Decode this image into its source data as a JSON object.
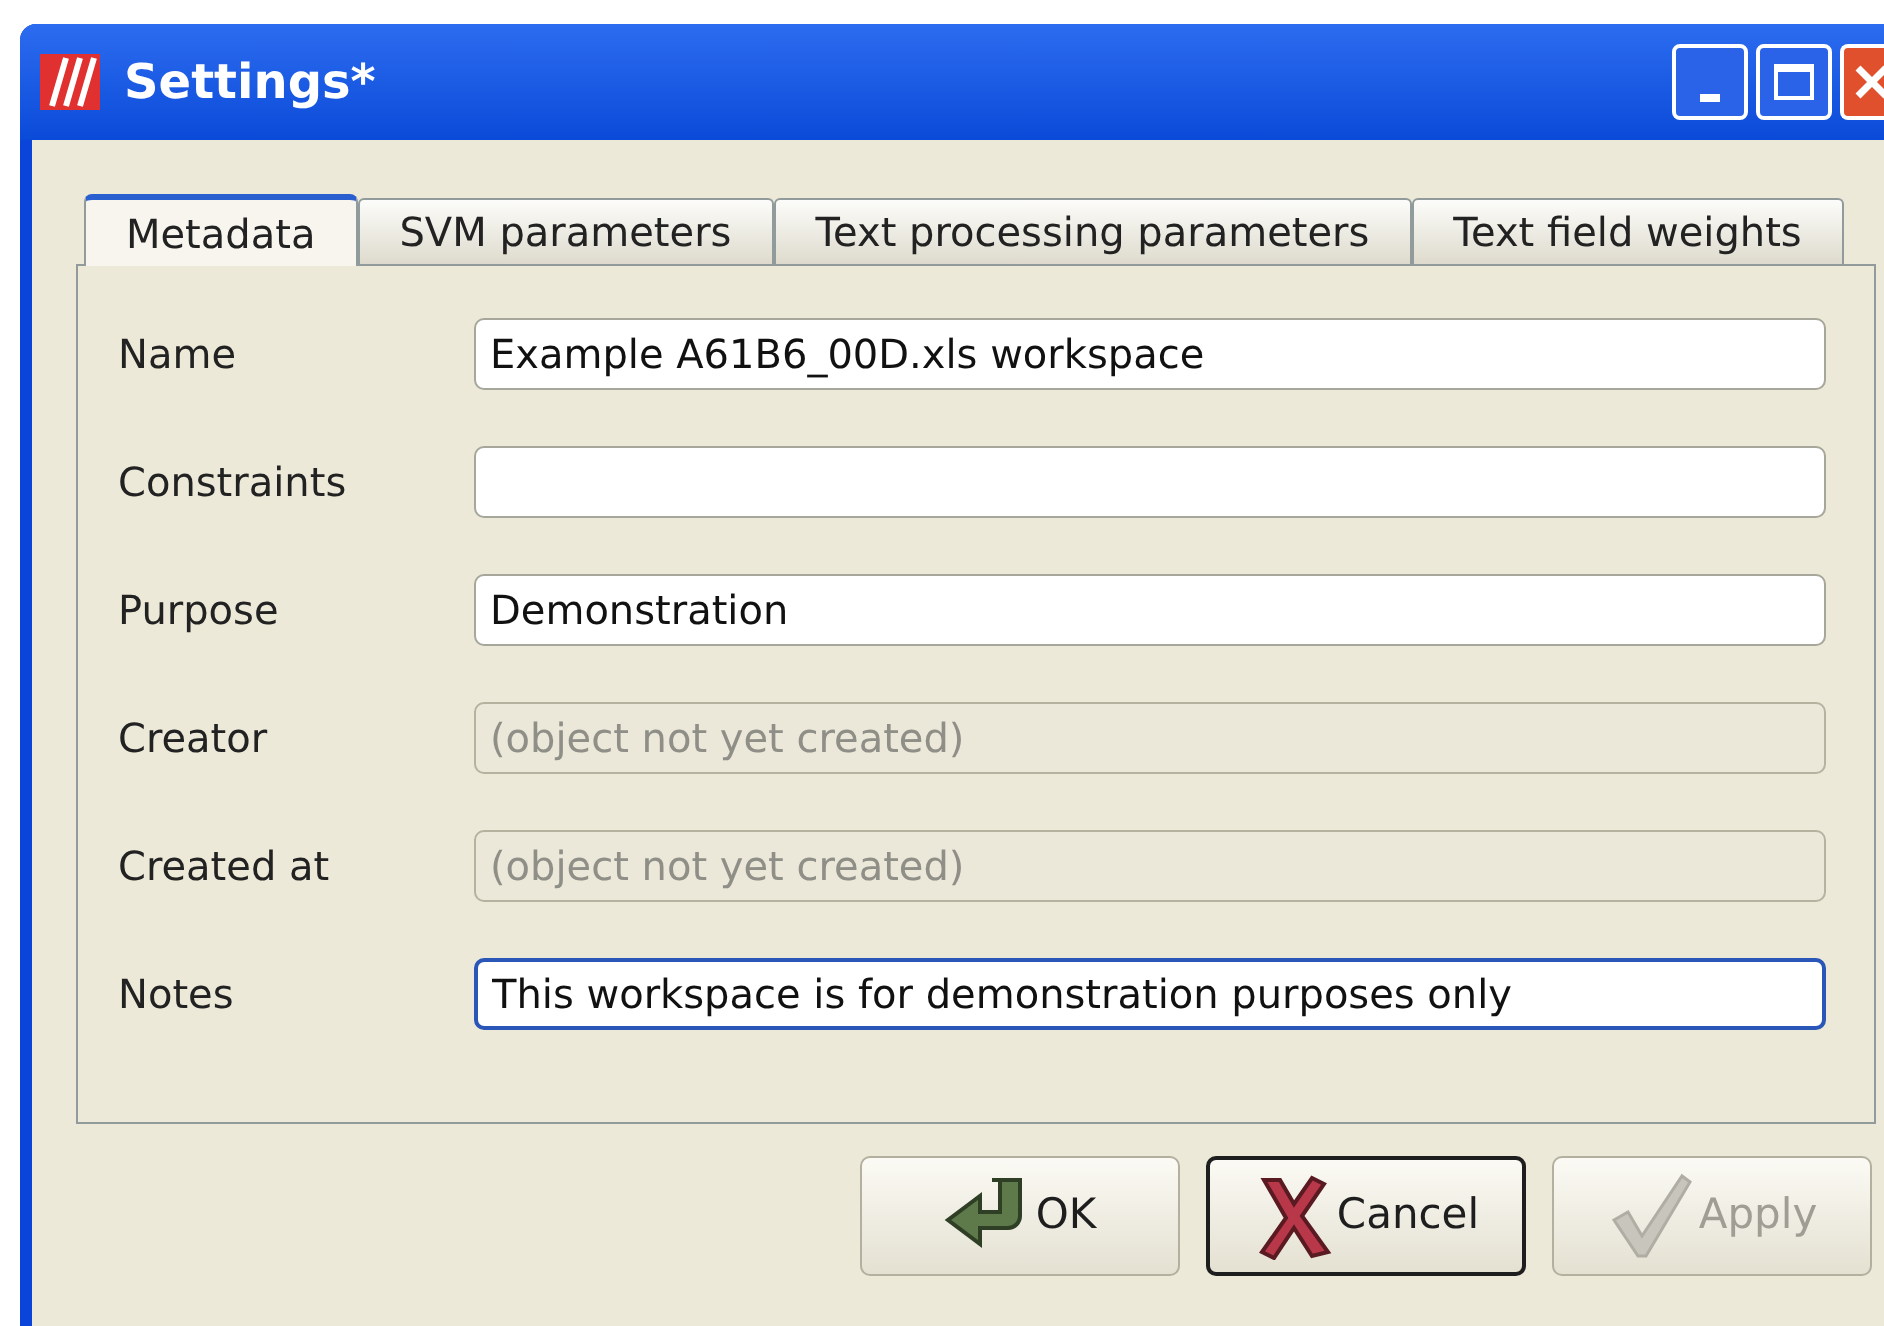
{
  "window": {
    "title": "Settings*"
  },
  "tabs": [
    {
      "label": "Metadata",
      "selected": true
    },
    {
      "label": "SVM parameters",
      "selected": false
    },
    {
      "label": "Text processing parameters",
      "selected": false
    },
    {
      "label": "Text field weights",
      "selected": false
    }
  ],
  "fields": [
    {
      "label": "Name",
      "value": "Example A61B6_00D.xls workspace",
      "disabled": false,
      "focused": false
    },
    {
      "label": "Constraints",
      "disabled": false,
      "focused": false
    },
    {
      "label": "Purpose",
      "value": "Demonstration",
      "disabled": false,
      "focused": false
    },
    {
      "label": "Creator",
      "value": "(object not yet created)",
      "disabled": true,
      "focused": false
    },
    {
      "label": "Created at",
      "value": "(object not yet created)",
      "disabled": true,
      "focused": false
    },
    {
      "label": "Notes",
      "value": "This workspace is for demonstration purposes only",
      "disabled": false,
      "focused": true
    }
  ],
  "buttons": [
    {
      "label": "OK",
      "kind": "ok",
      "default": false,
      "disabled": false
    },
    {
      "label": "Cancel",
      "kind": "cancel",
      "default": true,
      "disabled": false
    },
    {
      "label": "Apply",
      "kind": "apply",
      "default": false,
      "disabled": true
    }
  ]
}
